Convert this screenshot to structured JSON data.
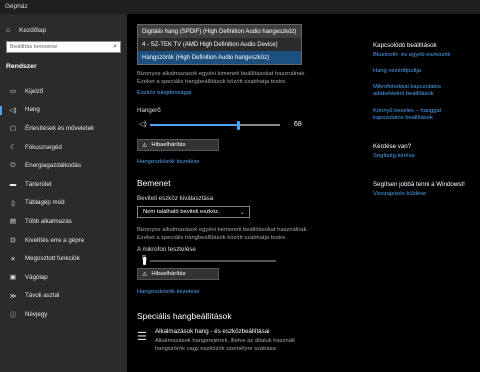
{
  "window": {
    "title": "Gépház"
  },
  "sidebar": {
    "home_label": "Kezdőlap",
    "search_placeholder": "Beállítás keresése",
    "section": "Rendszer",
    "items": [
      {
        "label": "Kijelző",
        "icon": "display-icon"
      },
      {
        "label": "Hang",
        "icon": "speaker-icon",
        "active": true
      },
      {
        "label": "Értesítések és műveletek",
        "icon": "notification-icon"
      },
      {
        "label": "Fókuszsegéd",
        "icon": "moon-icon"
      },
      {
        "label": "Energiagazdálkodás",
        "icon": "power-icon"
      },
      {
        "label": "Tárterület",
        "icon": "storage-icon"
      },
      {
        "label": "Táblagép mód",
        "icon": "tablet-icon"
      },
      {
        "label": "Több alkalmazás",
        "icon": "multitask-icon"
      },
      {
        "label": "Kivetítés erre a gépre",
        "icon": "project-icon"
      },
      {
        "label": "Megosztott funkciók",
        "icon": "share-icon"
      },
      {
        "label": "Vágólap",
        "icon": "clipboard-icon"
      },
      {
        "label": "Távoli asztal",
        "icon": "remote-icon"
      },
      {
        "label": "Névjegy",
        "icon": "info-icon"
      }
    ]
  },
  "output": {
    "dropdown_options": [
      "Digitális hang (SPDIF) (High Definition Audio hangeszköz)",
      "4 - SZ-TEK TV (AMD High Definition Audio Device)",
      "Hangszórók (High Definition Audio hangeszköz)"
    ],
    "dropdown_selected_index": 2,
    "desc": "Bizonyos alkalmazások egyéni kimeneti beállításokat használnak. Ezeket a speciális hangbeállítások között szabhatja testre.",
    "properties_link": "Eszköz tulajdonságai",
    "volume_label": "Hangerő",
    "volume_value": "68",
    "volume_fraction": 0.68,
    "troubleshoot_label": "Hibaelhárítás",
    "manage_link": "Hangeszközök kezelése"
  },
  "input": {
    "heading": "Bemenet",
    "device_label": "Beviteli eszköz kiválasztása",
    "device_value": "Nem található beviteli eszköz.",
    "desc": "Bizonyos alkalmazások egyéni bemeneti beállításokat használnak. Ezeket a speciális hangbeállítások között szabhatja testre.",
    "test_label": "A mikrofon tesztelése",
    "troubleshoot_label": "Hibaelhárítás",
    "manage_link": "Hangeszközök kezelése"
  },
  "advanced": {
    "heading": "Speciális hangbeállítások",
    "item_title": "Alkalmazások hang - és eszközbeállításai",
    "item_desc": "Alkalmazások hangerejének, illetve az általuk használt hangszórók vagy eszközök személyre szabása"
  },
  "related": {
    "title": "Kapcsolódó beállítások",
    "links": [
      "Bluetooth- és egyéb eszközök",
      "Hang vezérlőpultja",
      "Mikrofonokkal kapcsolatos adatvédelmi beállítások",
      "Könnyű kezelés – hanggal kapcsolatos beállítások"
    ],
    "question_title": "Kérdése van?",
    "help_link": "Segítség kérése",
    "improve_title": "Segítsen jobbá tenni a Windowst!",
    "feedback_link": "Visszajelzés küldése"
  },
  "colors": {
    "accent": "#4ea1f3",
    "sidebar_bg": "#2b2b2b",
    "main_bg": "#000000"
  }
}
